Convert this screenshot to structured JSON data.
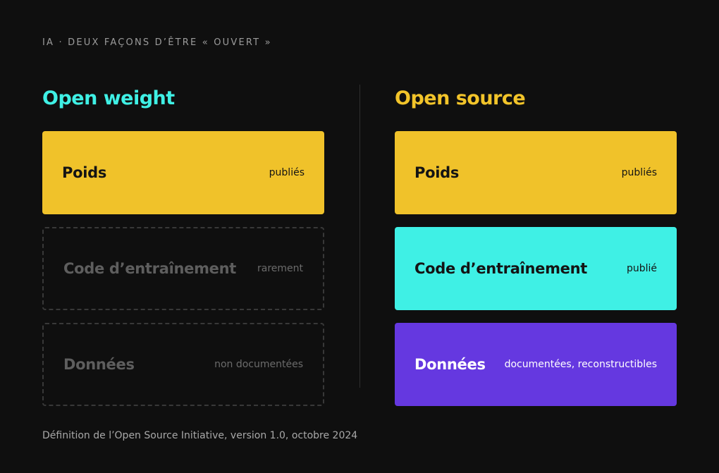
{
  "eyebrow": "IA · DEUX FAÇONS D’ÊTRE « OUVERT »",
  "columns": [
    {
      "title": "Open weight",
      "cards": [
        {
          "label": "Poids",
          "status": "publiés"
        },
        {
          "label": "Code d’entraînement",
          "status": "rarement"
        },
        {
          "label": "Données",
          "status": "non documentées"
        }
      ]
    },
    {
      "title": "Open source",
      "cards": [
        {
          "label": "Poids",
          "status": "publiés"
        },
        {
          "label": "Code d’entraînement",
          "status": "publié"
        },
        {
          "label": "Données",
          "status": "documentées, reconstructibles"
        }
      ]
    }
  ],
  "footnote": "Définition de l’Open Source Initiative, version 1.0, octobre 2024",
  "colors": {
    "background": "#0f0f0f",
    "yellow": "#f0c22a",
    "cyan": "#3ff0e5",
    "purple": "#6538e0",
    "ghost_border": "#383838"
  }
}
